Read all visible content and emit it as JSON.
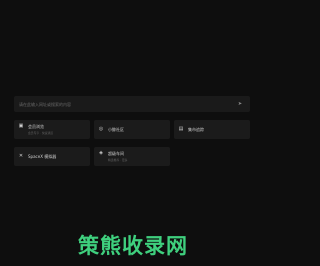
{
  "search": {
    "placeholder": "请在此输入网址或搜索的内容"
  },
  "icons": {
    "submit": "arrow-right-icon",
    "bookmark": "bookmark-icon",
    "compass": "compass-icon",
    "book": "book-icon",
    "spacex": "spacex-x-icon",
    "deal": "deal-tag-icon"
  },
  "cards": [
    {
      "title": "会员浏览",
      "desc": "会员专享 · 快速通道",
      "icon": "▣"
    },
    {
      "title": "小鲸社区",
      "desc": "",
      "icon": "◎"
    },
    {
      "title": "集市追踪",
      "desc": "",
      "icon": "▤"
    },
    {
      "title": "SpaceX 模拟器",
      "desc": "",
      "icon": "✕"
    },
    {
      "title": "超级车间",
      "desc": "精选推荐 · 更多",
      "icon": "◈"
    }
  ],
  "logo": {
    "text": "策熊收录网"
  },
  "colors": {
    "background": "#0e0e0e",
    "card": "#1b1b1b",
    "logo": "#3fd07e"
  }
}
